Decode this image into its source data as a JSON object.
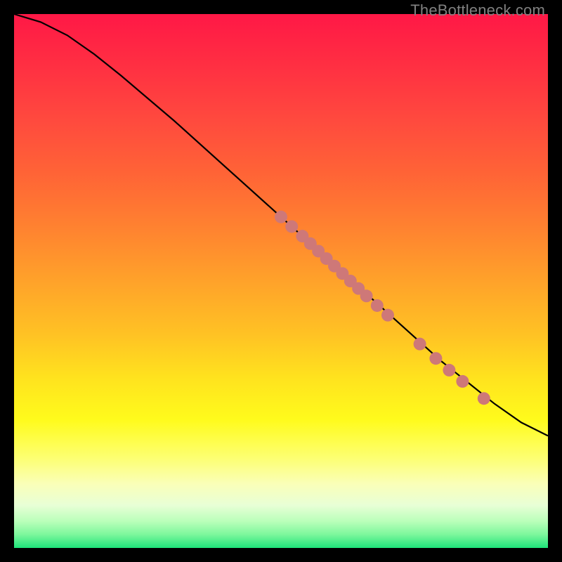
{
  "watermark": "TheBottleneck.com",
  "chart_data": {
    "type": "line",
    "title": "",
    "xlabel": "",
    "ylabel": "",
    "xlim": [
      0,
      100
    ],
    "ylim": [
      0,
      100
    ],
    "grid": false,
    "background_gradient": {
      "stops": [
        {
          "offset": 0.0,
          "color": "#ff1846"
        },
        {
          "offset": 0.1,
          "color": "#ff3042"
        },
        {
          "offset": 0.2,
          "color": "#ff4a3e"
        },
        {
          "offset": 0.3,
          "color": "#ff6436"
        },
        {
          "offset": 0.4,
          "color": "#ff8230"
        },
        {
          "offset": 0.5,
          "color": "#ffa22a"
        },
        {
          "offset": 0.6,
          "color": "#ffc224"
        },
        {
          "offset": 0.68,
          "color": "#ffe21e"
        },
        {
          "offset": 0.76,
          "color": "#fffb1c"
        },
        {
          "offset": 0.83,
          "color": "#fdff70"
        },
        {
          "offset": 0.88,
          "color": "#faffb8"
        },
        {
          "offset": 0.92,
          "color": "#e8ffd6"
        },
        {
          "offset": 0.95,
          "color": "#baffba"
        },
        {
          "offset": 0.975,
          "color": "#7cf79c"
        },
        {
          "offset": 1.0,
          "color": "#1ee47a"
        }
      ]
    },
    "series": [
      {
        "name": "curve",
        "type": "line",
        "stroke": "#000000",
        "points": [
          {
            "x": 0,
            "y": 100
          },
          {
            "x": 5,
            "y": 98.5
          },
          {
            "x": 10,
            "y": 96
          },
          {
            "x": 15,
            "y": 92.5
          },
          {
            "x": 20,
            "y": 88.5
          },
          {
            "x": 30,
            "y": 80
          },
          {
            "x": 40,
            "y": 71
          },
          {
            "x": 50,
            "y": 62
          },
          {
            "x": 60,
            "y": 53
          },
          {
            "x": 70,
            "y": 44
          },
          {
            "x": 80,
            "y": 35
          },
          {
            "x": 85,
            "y": 31
          },
          {
            "x": 90,
            "y": 27
          },
          {
            "x": 95,
            "y": 23.5
          },
          {
            "x": 100,
            "y": 21
          }
        ]
      },
      {
        "name": "cluster-points",
        "type": "scatter",
        "color": "#ce7878",
        "radius": 9,
        "points": [
          {
            "x": 50,
            "y": 62
          },
          {
            "x": 52,
            "y": 60.2
          },
          {
            "x": 54,
            "y": 58.4
          },
          {
            "x": 55.5,
            "y": 57
          },
          {
            "x": 57,
            "y": 55.6
          },
          {
            "x": 58.5,
            "y": 54.2
          },
          {
            "x": 60,
            "y": 52.8
          },
          {
            "x": 61.5,
            "y": 51.4
          },
          {
            "x": 63,
            "y": 50
          },
          {
            "x": 64.5,
            "y": 48.6
          },
          {
            "x": 66,
            "y": 47.2
          },
          {
            "x": 68,
            "y": 45.4
          },
          {
            "x": 70,
            "y": 43.6
          },
          {
            "x": 76,
            "y": 38.2
          },
          {
            "x": 79,
            "y": 35.5
          },
          {
            "x": 81.5,
            "y": 33.3
          },
          {
            "x": 84,
            "y": 31.2
          },
          {
            "x": 88,
            "y": 28
          }
        ]
      }
    ]
  }
}
